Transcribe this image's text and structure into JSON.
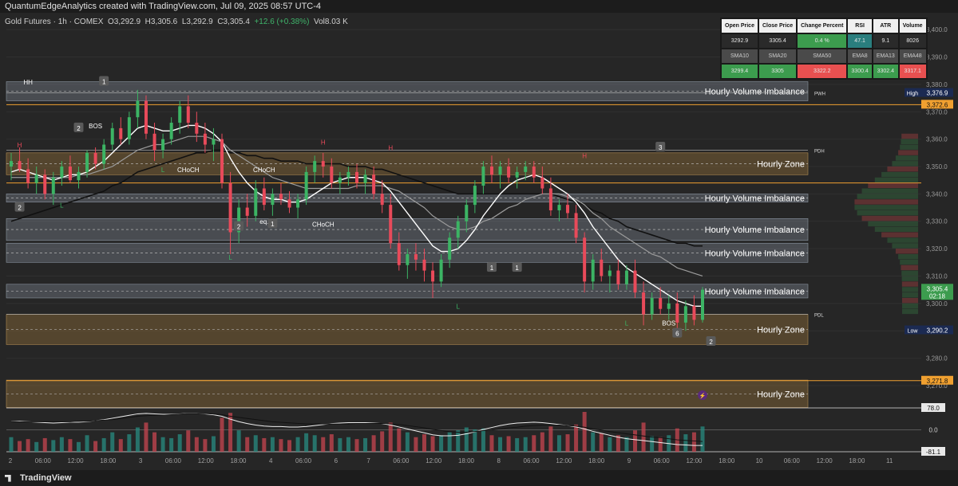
{
  "header": {
    "author_line": "QuantumEdgeAnalytics created with TradingView.com, Jul 09, 2025 08:57 UTC-4",
    "symbol": "Gold Futures · 1h · COMEX",
    "open": "O3,292.9",
    "high": "H3,305.6",
    "low": "L3,292.9",
    "close": "C3,305.4",
    "change": "+12.6 (+0.38%)",
    "volume": "Vol8.03 K"
  },
  "stats_table": {
    "headers1": [
      "Open Price",
      "Close Price",
      "Change Percent",
      "RSI",
      "ATR",
      "Volume"
    ],
    "values1": [
      "3292.9",
      "3305.4",
      "0.4 %",
      "47.1",
      "9.1",
      "8026"
    ],
    "headers2": [
      "SMA10",
      "SMA20",
      "SMA50",
      "EMA8",
      "EMA13",
      "EMA48"
    ],
    "values2": [
      "3299.4",
      "3305",
      "3322.2",
      "3300.4",
      "3302.4",
      "3317.1"
    ],
    "colors": {
      "green": "#3c9c4e",
      "teal": "#2a7e7e",
      "red": "#e85050"
    }
  },
  "chart_data": {
    "type": "candlestick",
    "ylim": [
      3263,
      3405
    ],
    "y_ticks": [
      3270,
      3280,
      3290,
      3300,
      3310,
      3320,
      3330,
      3340,
      3350,
      3360,
      3370,
      3380,
      3390,
      3400
    ],
    "x_labels": [
      "2",
      "06:00",
      "12:00",
      "18:00",
      "3",
      "06:00",
      "12:00",
      "18:00",
      "4",
      "06:00",
      "6",
      "7",
      "06:00",
      "12:00",
      "18:00",
      "8",
      "06:00",
      "12:00",
      "18:00",
      "9",
      "06:00",
      "12:00",
      "18:00",
      "10",
      "06:00",
      "12:00",
      "18:00",
      "11"
    ],
    "price_labels": [
      {
        "label": "High",
        "value": "3,376.9",
        "y": 3376.9,
        "color": "#1b2a52"
      },
      {
        "label": "",
        "value": "3,372.6",
        "y": 3372.6,
        "color": "#f0a030"
      },
      {
        "label": "",
        "value": "3,305.4\n02:18",
        "y": 3305.4,
        "color": "#3c9c4e"
      },
      {
        "label": "Low",
        "value": "3,290.2",
        "y": 3290.2,
        "color": "#1b2a52"
      },
      {
        "label": "",
        "value": "3,271.8",
        "y": 3271.8,
        "color": "#f0a030"
      }
    ],
    "zones": [
      {
        "label": "Hourly Volume Imbalance",
        "top": 3381,
        "bottom": 3374,
        "kind": "imbalance"
      },
      {
        "label": "Hourly Zone",
        "top": 3355,
        "bottom": 3347,
        "kind": "zone"
      },
      {
        "label": "Hourly Volume Imbalance",
        "top": 3340,
        "bottom": 3337,
        "kind": "imbalance"
      },
      {
        "label": "Hourly Volume Imbalance",
        "top": 3331,
        "bottom": 3323,
        "kind": "imbalance"
      },
      {
        "label": "Hourly Volume Imbalance",
        "top": 3322,
        "bottom": 3315,
        "kind": "imbalance"
      },
      {
        "label": "Hourly Volume Imbalance",
        "top": 3307,
        "bottom": 3302,
        "kind": "imbalance"
      },
      {
        "label": "Hourly Zone",
        "top": 3296,
        "bottom": 3285,
        "kind": "zone"
      },
      {
        "label": "Hourly Zone",
        "top": 3272,
        "bottom": 3262,
        "kind": "zone"
      }
    ],
    "level_tags": [
      {
        "label": "PWH",
        "y": 3376.9
      },
      {
        "label": "PDH",
        "y": 3356
      },
      {
        "label": "PDL",
        "y": 3296
      }
    ],
    "annotations": [
      {
        "text": "HH",
        "x": 2,
        "y": 3380
      },
      {
        "text": "BOS",
        "x": 10,
        "y": 3364
      },
      {
        "text": "CHoCH",
        "x": 21,
        "y": 3348
      },
      {
        "text": "CHoCH",
        "x": 30,
        "y": 3348
      },
      {
        "text": "CHoCH",
        "x": 37,
        "y": 3328
      },
      {
        "text": "eq.",
        "x": 30,
        "y": 3329
      },
      {
        "text": "BOS",
        "x": 78,
        "y": 3292
      },
      {
        "text": "H",
        "x": 1,
        "y": 3357
      },
      {
        "text": "H",
        "x": 37,
        "y": 3358
      },
      {
        "text": "H",
        "x": 45,
        "y": 3356
      },
      {
        "text": "H",
        "x": 68,
        "y": 3353
      },
      {
        "text": "L",
        "x": 6,
        "y": 3335
      },
      {
        "text": "L",
        "x": 18,
        "y": 3348
      },
      {
        "text": "L",
        "x": 26,
        "y": 3316
      },
      {
        "text": "L",
        "x": 53,
        "y": 3298
      },
      {
        "text": "L",
        "x": 73,
        "y": 3292
      }
    ],
    "markers": [
      "2",
      "2",
      "1",
      "2",
      "1",
      "1",
      "3",
      "1",
      "6",
      "2"
    ],
    "ohlc": [
      [
        3350,
        3355,
        3345,
        3352
      ],
      [
        3352,
        3357,
        3348,
        3349
      ],
      [
        3349,
        3353,
        3342,
        3344
      ],
      [
        3344,
        3350,
        3340,
        3347
      ],
      [
        3347,
        3349,
        3338,
        3340
      ],
      [
        3340,
        3348,
        3336,
        3346
      ],
      [
        3346,
        3352,
        3343,
        3350
      ],
      [
        3350,
        3354,
        3344,
        3345
      ],
      [
        3345,
        3350,
        3342,
        3348
      ],
      [
        3348,
        3356,
        3346,
        3355
      ],
      [
        3355,
        3357,
        3349,
        3351
      ],
      [
        3351,
        3360,
        3349,
        3358
      ],
      [
        3358,
        3366,
        3356,
        3364
      ],
      [
        3364,
        3368,
        3358,
        3360
      ],
      [
        3360,
        3370,
        3358,
        3368
      ],
      [
        3368,
        3378,
        3364,
        3374
      ],
      [
        3374,
        3376,
        3360,
        3362
      ],
      [
        3362,
        3366,
        3352,
        3356
      ],
      [
        3356,
        3362,
        3353,
        3360
      ],
      [
        3360,
        3368,
        3358,
        3366
      ],
      [
        3366,
        3374,
        3362,
        3372
      ],
      [
        3372,
        3376,
        3364,
        3366
      ],
      [
        3366,
        3370,
        3359,
        3362
      ],
      [
        3362,
        3366,
        3355,
        3358
      ],
      [
        3358,
        3364,
        3352,
        3360
      ],
      [
        3360,
        3362,
        3342,
        3344
      ],
      [
        3344,
        3348,
        3318,
        3326
      ],
      [
        3326,
        3338,
        3322,
        3335
      ],
      [
        3335,
        3340,
        3328,
        3332
      ],
      [
        3332,
        3345,
        3330,
        3342
      ],
      [
        3342,
        3346,
        3334,
        3336
      ],
      [
        3336,
        3342,
        3332,
        3340
      ],
      [
        3340,
        3344,
        3336,
        3338
      ],
      [
        3338,
        3341,
        3333,
        3335
      ],
      [
        3335,
        3340,
        3331,
        3338
      ],
      [
        3338,
        3350,
        3336,
        3348
      ],
      [
        3348,
        3354,
        3344,
        3352
      ],
      [
        3352,
        3355,
        3346,
        3350
      ],
      [
        3350,
        3353,
        3342,
        3344
      ],
      [
        3344,
        3348,
        3340,
        3346
      ],
      [
        3346,
        3350,
        3343,
        3348
      ],
      [
        3348,
        3351,
        3342,
        3344
      ],
      [
        3344,
        3349,
        3340,
        3347
      ],
      [
        3347,
        3350,
        3338,
        3340
      ],
      [
        3340,
        3345,
        3333,
        3336
      ],
      [
        3336,
        3340,
        3320,
        3322
      ],
      [
        3322,
        3326,
        3312,
        3314
      ],
      [
        3314,
        3320,
        3309,
        3318
      ],
      [
        3318,
        3322,
        3312,
        3316
      ],
      [
        3316,
        3320,
        3308,
        3312
      ],
      [
        3312,
        3315,
        3302,
        3308
      ],
      [
        3308,
        3318,
        3306,
        3316
      ],
      [
        3316,
        3326,
        3313,
        3324
      ],
      [
        3324,
        3332,
        3320,
        3330
      ],
      [
        3330,
        3338,
        3326,
        3336
      ],
      [
        3336,
        3345,
        3333,
        3343
      ],
      [
        3343,
        3352,
        3340,
        3350
      ],
      [
        3350,
        3354,
        3344,
        3347
      ],
      [
        3347,
        3352,
        3342,
        3350
      ],
      [
        3350,
        3353,
        3344,
        3346
      ],
      [
        3346,
        3350,
        3342,
        3348
      ],
      [
        3348,
        3352,
        3345,
        3350
      ],
      [
        3350,
        3352,
        3344,
        3346
      ],
      [
        3346,
        3350,
        3340,
        3342
      ],
      [
        3342,
        3346,
        3332,
        3334
      ],
      [
        3334,
        3338,
        3330,
        3336
      ],
      [
        3336,
        3340,
        3331,
        3333
      ],
      [
        3333,
        3336,
        3322,
        3324
      ],
      [
        3324,
        3326,
        3304,
        3308
      ],
      [
        3308,
        3318,
        3305,
        3316
      ],
      [
        3316,
        3320,
        3308,
        3310
      ],
      [
        3310,
        3314,
        3304,
        3312
      ],
      [
        3312,
        3316,
        3305,
        3307
      ],
      [
        3307,
        3314,
        3305,
        3312
      ],
      [
        3312,
        3316,
        3302,
        3304
      ],
      [
        3304,
        3308,
        3292,
        3296
      ],
      [
        3296,
        3304,
        3294,
        3302
      ],
      [
        3302,
        3306,
        3296,
        3298
      ],
      [
        3298,
        3303,
        3294,
        3300
      ],
      [
        3300,
        3304,
        3290,
        3293
      ],
      [
        3293,
        3301,
        3290,
        3299
      ],
      [
        3299,
        3303,
        3292,
        3294
      ],
      [
        3294,
        3306,
        3293,
        3305
      ]
    ],
    "sma_fast": [
      3348,
      3349,
      3348,
      3347,
      3346,
      3345,
      3346,
      3347,
      3347,
      3348,
      3350,
      3352,
      3355,
      3358,
      3361,
      3364,
      3365,
      3364,
      3363,
      3363,
      3364,
      3365,
      3365,
      3364,
      3362,
      3359,
      3353,
      3348,
      3344,
      3341,
      3339,
      3338,
      3338,
      3337,
      3337,
      3338,
      3340,
      3342,
      3344,
      3345,
      3346,
      3346,
      3346,
      3345,
      3344,
      3341,
      3337,
      3333,
      3329,
      3325,
      3321,
      3319,
      3319,
      3320,
      3323,
      3327,
      3332,
      3336,
      3340,
      3343,
      3345,
      3346,
      3347,
      3346,
      3344,
      3342,
      3340,
      3337,
      3333,
      3328,
      3324,
      3320,
      3316,
      3313,
      3311,
      3309,
      3307,
      3305,
      3303,
      3301,
      3300,
      3299,
      3299
    ],
    "sma_slow": [
      3346,
      3346,
      3346,
      3346,
      3346,
      3346,
      3346,
      3346,
      3347,
      3347,
      3348,
      3349,
      3350,
      3352,
      3354,
      3356,
      3357,
      3358,
      3358,
      3359,
      3360,
      3361,
      3361,
      3361,
      3360,
      3359,
      3356,
      3354,
      3352,
      3350,
      3348,
      3346,
      3345,
      3344,
      3343,
      3342,
      3342,
      3342,
      3342,
      3342,
      3342,
      3343,
      3343,
      3343,
      3343,
      3342,
      3341,
      3339,
      3337,
      3335,
      3332,
      3330,
      3328,
      3327,
      3327,
      3328,
      3330,
      3331,
      3333,
      3335,
      3336,
      3338,
      3339,
      3340,
      3340,
      3340,
      3339,
      3338,
      3336,
      3333,
      3331,
      3328,
      3326,
      3324,
      3322,
      3320,
      3318,
      3317,
      3315,
      3313,
      3312,
      3311,
      3310
    ],
    "ema_long": [
      3330,
      3331,
      3332,
      3333,
      3334,
      3335,
      3336,
      3337,
      3338,
      3339,
      3340,
      3341,
      3343,
      3344,
      3346,
      3348,
      3349,
      3350,
      3351,
      3352,
      3353,
      3354,
      3355,
      3355,
      3356,
      3356,
      3355,
      3355,
      3354,
      3354,
      3353,
      3353,
      3352,
      3352,
      3352,
      3351,
      3351,
      3351,
      3351,
      3351,
      3350,
      3350,
      3350,
      3349,
      3349,
      3348,
      3347,
      3346,
      3345,
      3344,
      3343,
      3342,
      3341,
      3340,
      3340,
      3340,
      3340,
      3340,
      3340,
      3340,
      3340,
      3340,
      3340,
      3340,
      3340,
      3339,
      3338,
      3337,
      3336,
      3334,
      3333,
      3331,
      3330,
      3328,
      3327,
      3326,
      3325,
      3324,
      3323,
      3322,
      3322,
      3321,
      3321
    ],
    "volume": [
      30,
      22,
      26,
      20,
      28,
      24,
      30,
      26,
      20,
      34,
      22,
      28,
      40,
      26,
      36,
      50,
      60,
      40,
      30,
      28,
      36,
      44,
      30,
      26,
      32,
      70,
      80,
      44,
      30,
      34,
      28,
      30,
      26,
      24,
      30,
      38,
      34,
      30,
      36,
      28,
      30,
      26,
      28,
      34,
      42,
      60,
      48,
      40,
      30,
      36,
      32,
      34,
      40,
      44,
      50,
      46,
      48,
      34,
      30,
      32,
      28,
      30,
      34,
      40,
      52,
      34,
      36,
      56,
      82,
      40,
      38,
      30,
      34,
      30,
      44,
      60,
      32,
      30,
      34,
      48,
      36,
      40,
      52
    ],
    "oscillator": {
      "upper": "78.0",
      "middle": "0.0",
      "lower": "-81.1"
    }
  }
}
